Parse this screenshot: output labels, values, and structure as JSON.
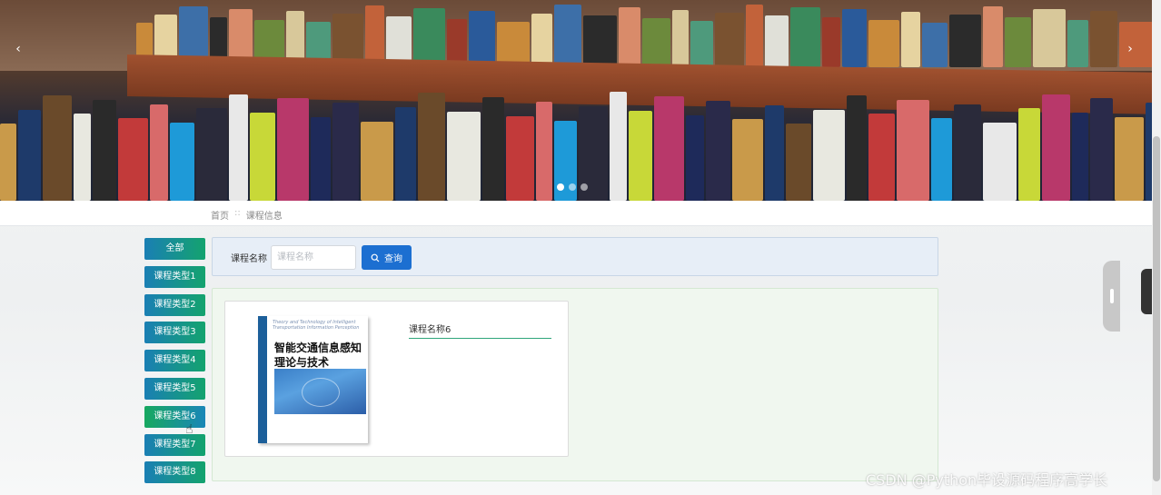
{
  "banner": {
    "prev_arrow": "‹",
    "next_arrow": "›",
    "slide_count": 3,
    "active_slide": 1
  },
  "breadcrumb": {
    "home": "首页",
    "separator": "::",
    "current": "课程信息"
  },
  "sidebar": {
    "items": [
      {
        "label": "全部",
        "active": false
      },
      {
        "label": "课程类型1",
        "active": false
      },
      {
        "label": "课程类型2",
        "active": false
      },
      {
        "label": "课程类型3",
        "active": false
      },
      {
        "label": "课程类型4",
        "active": false
      },
      {
        "label": "课程类型5",
        "active": false
      },
      {
        "label": "课程类型6",
        "active": true
      },
      {
        "label": "课程类型7",
        "active": false
      },
      {
        "label": "课程类型8",
        "active": false
      }
    ]
  },
  "search": {
    "label": "课程名称",
    "placeholder": "课程名称",
    "value": "",
    "button_label": "查询",
    "button_icon": "search-icon"
  },
  "courses": [
    {
      "name": "课程名称6",
      "cover": {
        "top_text": "Theory and Technology of Intelligent Transportation Information Perception",
        "title": "智能交通信息感知理论与技术"
      }
    }
  ],
  "watermark": "CSDN @Python毕设源码程序高学长",
  "colors": {
    "primary_blue": "#1c6fd1",
    "accent_green": "#2fa57a",
    "search_panel_bg": "#e7eef7",
    "content_panel_bg": "#f0f7ef"
  }
}
